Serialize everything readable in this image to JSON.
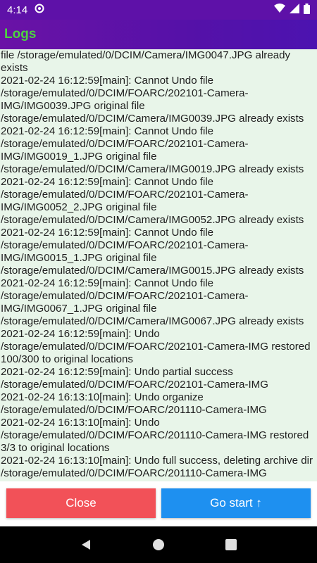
{
  "status_bar": {
    "time": "4:14",
    "icons": [
      "at-sign-icon",
      "wifi-icon",
      "signal-icon",
      "battery-icon"
    ]
  },
  "app_bar": {
    "title": "Logs",
    "title_color": "#4cd43f",
    "background": "#5a12a8"
  },
  "log": {
    "lines": [
      "file /storage/emulated/0/DCIM/Camera/IMG0047.JPG already exists",
      "2021-02-24 16:12:59[main]: Cannot Undo file /storage/emulated/0/DCIM/FOARC/202101-Camera-IMG/IMG0039.JPG original file /storage/emulated/0/DCIM/Camera/IMG0039.JPG already exists",
      "2021-02-24 16:12:59[main]: Cannot Undo file /storage/emulated/0/DCIM/FOARC/202101-Camera-IMG/IMG0019_1.JPG original file /storage/emulated/0/DCIM/Camera/IMG0019.JPG already exists",
      "2021-02-24 16:12:59[main]: Cannot Undo file /storage/emulated/0/DCIM/FOARC/202101-Camera-IMG/IMG0052_2.JPG original file /storage/emulated/0/DCIM/Camera/IMG0052.JPG already exists",
      "2021-02-24 16:12:59[main]: Cannot Undo file /storage/emulated/0/DCIM/FOARC/202101-Camera-IMG/IMG0015_1.JPG original file /storage/emulated/0/DCIM/Camera/IMG0015.JPG already exists",
      "2021-02-24 16:12:59[main]: Cannot Undo file /storage/emulated/0/DCIM/FOARC/202101-Camera-IMG/IMG0067_1.JPG original file /storage/emulated/0/DCIM/Camera/IMG0067.JPG already exists",
      "2021-02-24 16:12:59[main]: Undo /storage/emulated/0/DCIM/FOARC/202101-Camera-IMG restored 100/300 to original locations",
      "2021-02-24 16:12:59[main]: Undo partial success /storage/emulated/0/DCIM/FOARC/202101-Camera-IMG",
      "2021-02-24 16:13:10[main]: Undo organize /storage/emulated/0/DCIM/FOARC/201110-Camera-IMG",
      "2021-02-24 16:13:10[main]: Undo /storage/emulated/0/DCIM/FOARC/201110-Camera-IMG restored 3/3 to original locations",
      "2021-02-24 16:13:10[main]: Undo full success, deleting archive dir /storage/emulated/0/DCIM/FOARC/201110-Camera-IMG"
    ]
  },
  "buttons": {
    "close_label": "Close",
    "close_color": "#f25158",
    "start_label": "Go start ↑",
    "start_color": "#1e90f0"
  },
  "nav_bar": {
    "icons": [
      "back-icon",
      "home-icon",
      "recents-icon"
    ]
  }
}
